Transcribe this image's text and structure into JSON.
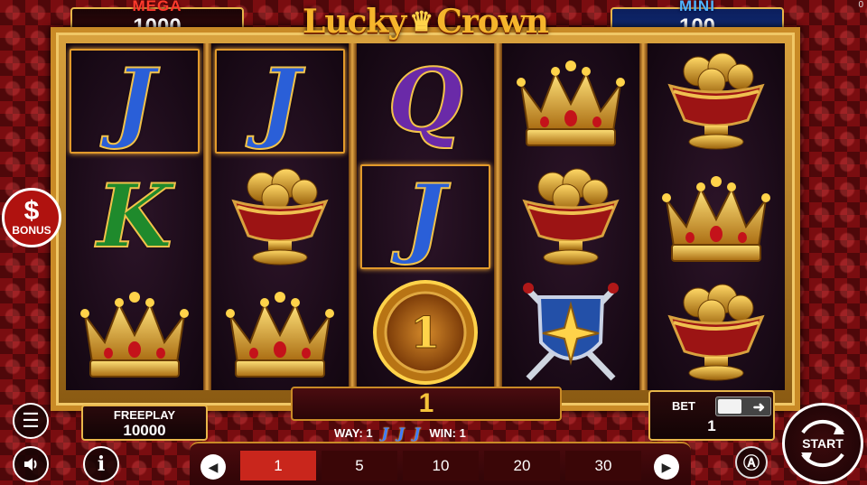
{
  "header": {
    "mega_label": "MEGA",
    "mega_value": "1000",
    "mini_label": "MINI",
    "mini_value": "100",
    "logo_left": "Lucky",
    "logo_right": "Crown",
    "corner_counter": "0"
  },
  "reels": [
    [
      "J",
      "K",
      "crown"
    ],
    [
      "J",
      "bowl",
      "crown"
    ],
    [
      "Q",
      "J",
      "coin"
    ],
    [
      "crown",
      "bowl",
      "shield"
    ],
    [
      "bowl",
      "crown",
      "bowl"
    ]
  ],
  "coin_value": "1",
  "colors": {
    "J": "#2a5fd8",
    "K": "#1f8a2c",
    "Q": "#6a2aa8",
    "gold": "#e8b64a",
    "selected_bet": "#c9261c"
  },
  "bonus": {
    "symbol": "$",
    "label": "BONUS"
  },
  "freeplay": {
    "label": "FREEPLAY",
    "value": "10000"
  },
  "win": {
    "total": "1",
    "way_label": "WAY: 1",
    "win_label": "WIN: 1",
    "way_symbol": "J"
  },
  "bet": {
    "label": "BET",
    "value": "1"
  },
  "bet_options": [
    "1",
    "5",
    "10",
    "20",
    "30"
  ],
  "selected_bet_index": 0,
  "buttons": {
    "start": "START",
    "menu_icon": "menu-icon",
    "sound_icon": "speaker-icon",
    "info_icon": "info-icon",
    "auto_icon": "autoplay-icon"
  }
}
